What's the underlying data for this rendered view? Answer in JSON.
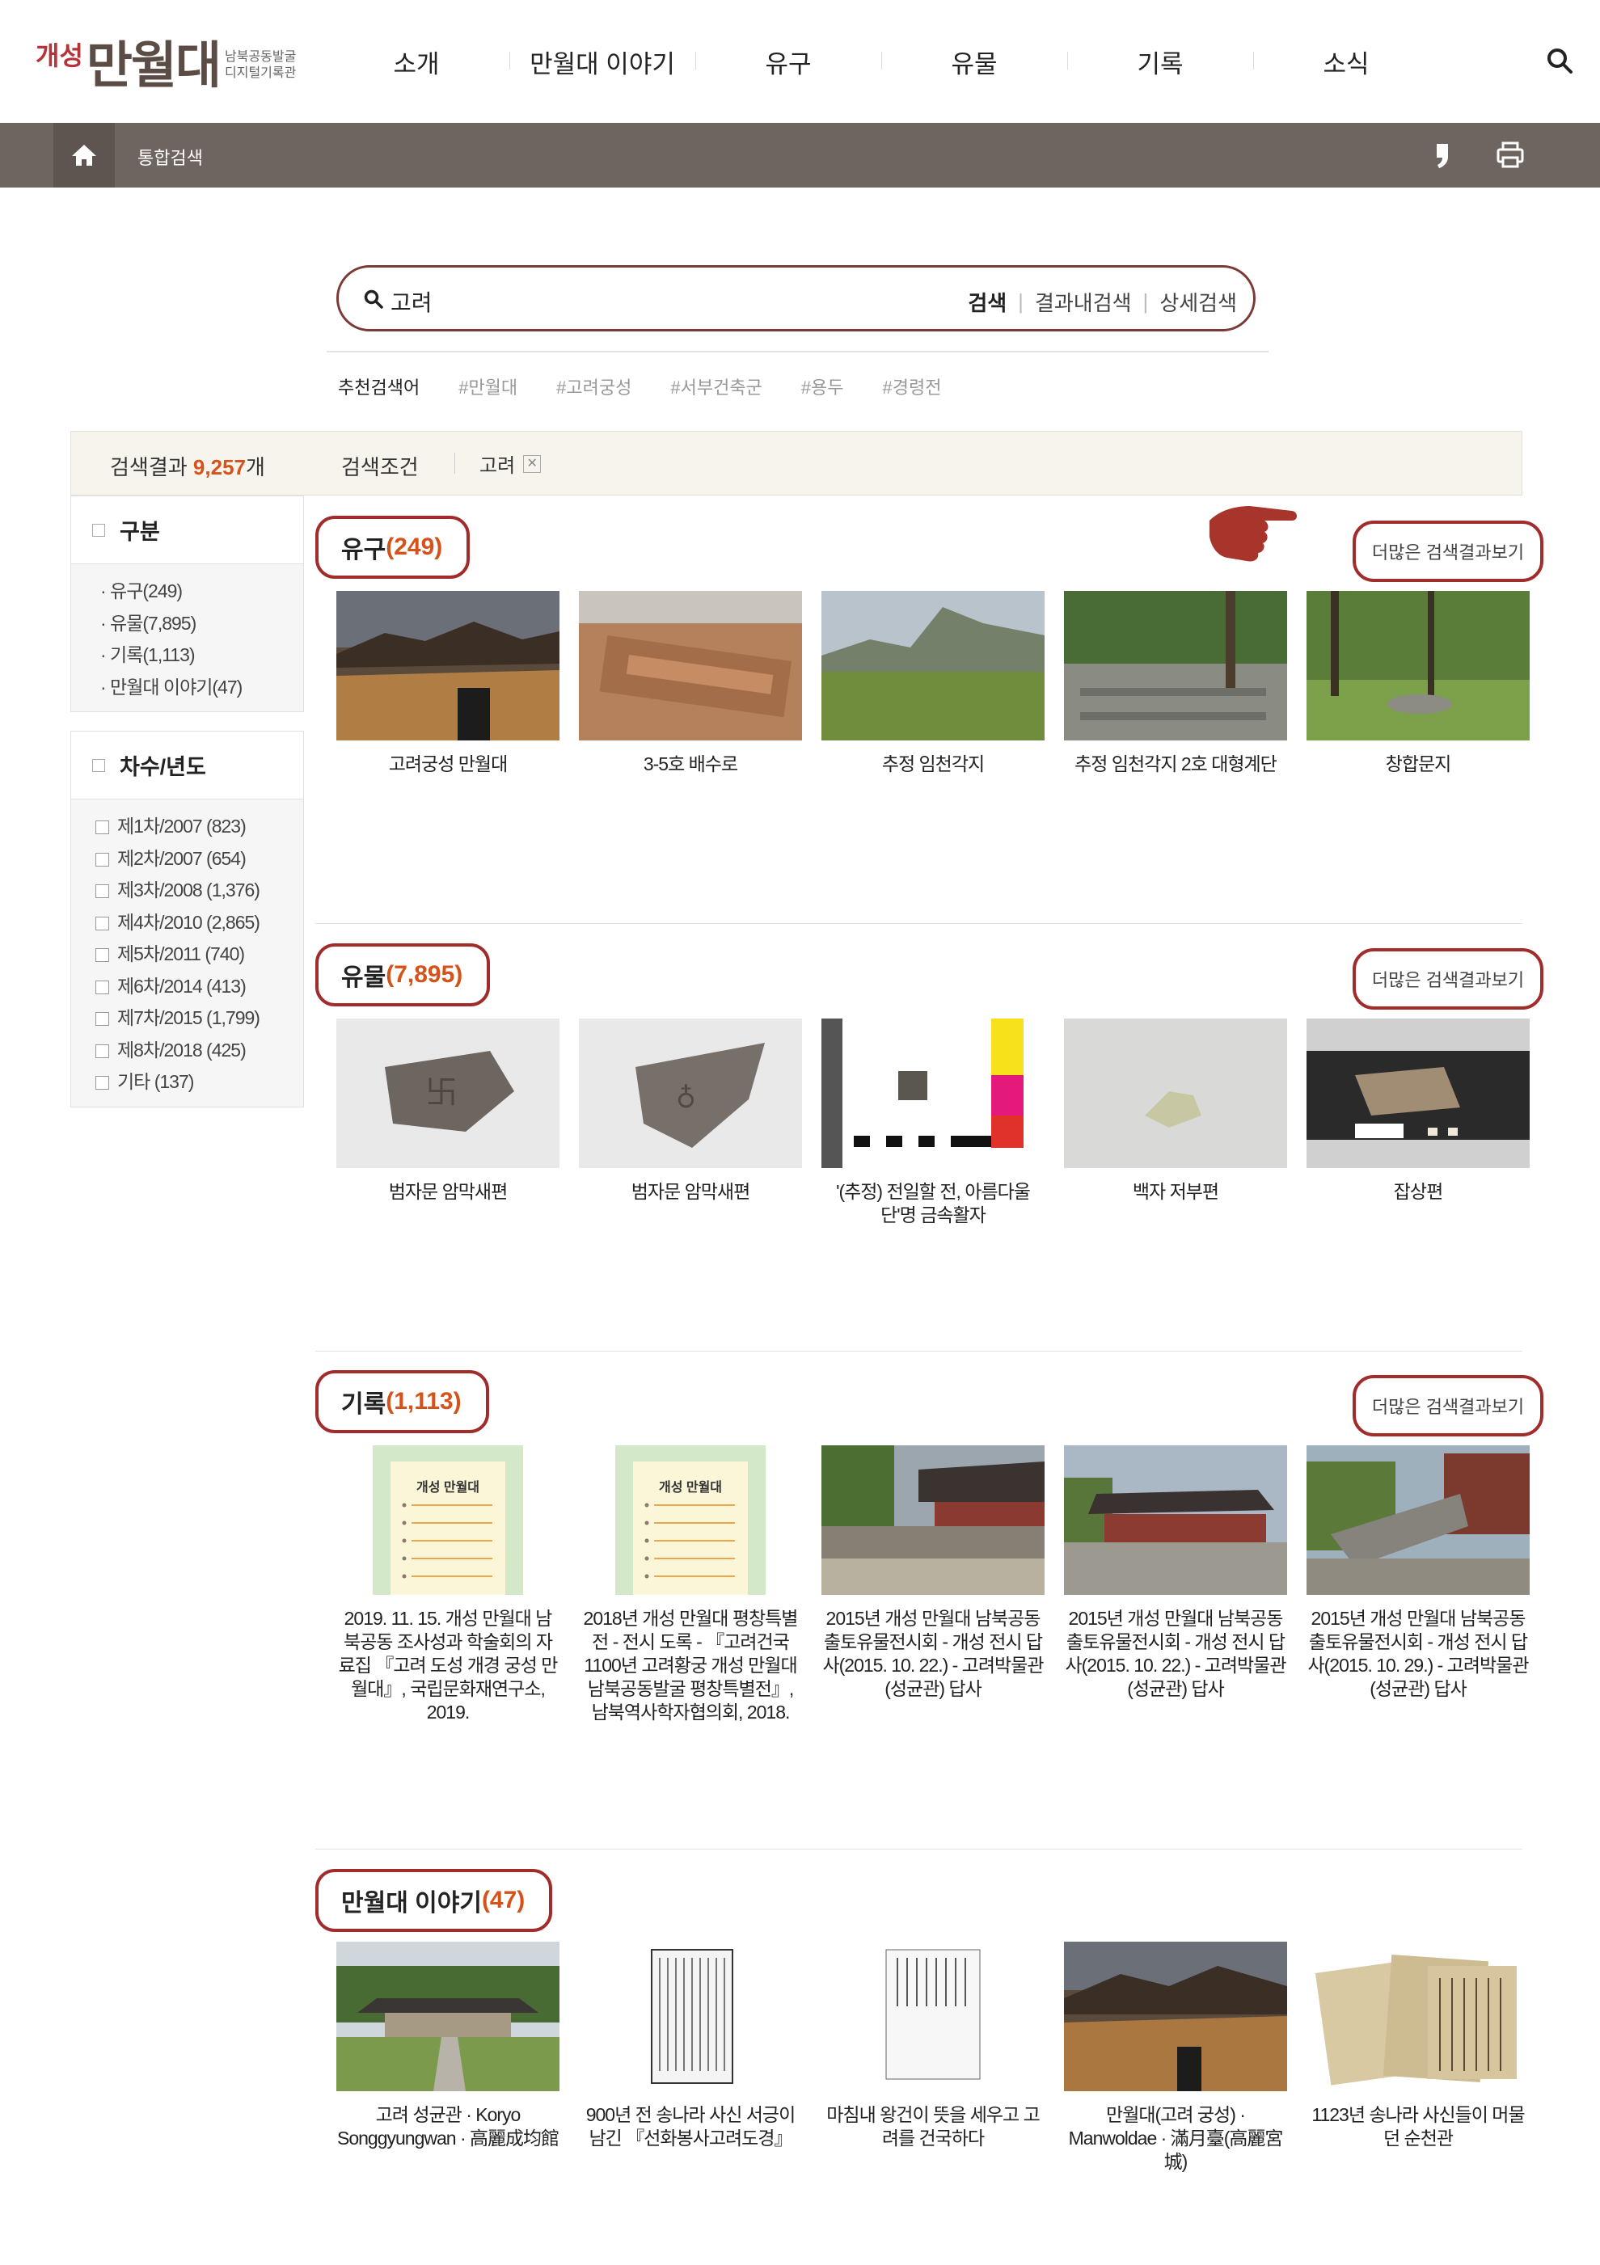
{
  "header": {
    "logo": {
      "prefix": "개성",
      "main": "만월대",
      "sub1": "남북공동발굴",
      "sub2": "디지털기록관"
    },
    "nav": [
      "소개",
      "만월대 이야기",
      "유구",
      "유물",
      "기록",
      "소식"
    ]
  },
  "location": {
    "title": "통합검색"
  },
  "search": {
    "value": "고려",
    "buttons": [
      "검색",
      "결과내검색",
      "상세검색"
    ],
    "recommend_label": "추천검색어",
    "recommend_tags": [
      "#만월대",
      "#고려궁성",
      "#서부건축군",
      "#용두",
      "#경령전"
    ]
  },
  "results": {
    "label": "검색결과",
    "count": "9,257",
    "unit": "개",
    "condition_label": "검색조건",
    "keyword": "고려"
  },
  "sidebar": {
    "category": {
      "title": "구분",
      "items": [
        "· 유구(249)",
        "· 유물(7,895)",
        "· 기록(1,113)",
        "· 만월대 이야기(47)"
      ]
    },
    "year": {
      "title": "차수/년도",
      "items": [
        "제1차/2007 (823)",
        "제2차/2007 (654)",
        "제3차/2008 (1,376)",
        "제4차/2010 (2,865)",
        "제5차/2011 (740)",
        "제6차/2014 (413)",
        "제7차/2015 (1,799)",
        "제8차/2018 (425)",
        "기타 (137)"
      ]
    }
  },
  "more_label": "더많은 검색결과보기",
  "sections": [
    {
      "name": "유구",
      "count": "(249)",
      "items": [
        "고려궁성 만월대",
        "3-5호 배수로",
        "추정 임천각지",
        "추정 임천각지 2호 대형계단",
        "창합문지"
      ]
    },
    {
      "name": "유물",
      "count": "(7,895)",
      "items": [
        "범자문 암막새편",
        "범자문 암막새편",
        "'(추정) 전일할 전, 아름다울 단'명 금속활자",
        "백자 저부편",
        "잡상편"
      ]
    },
    {
      "name": "기록",
      "count": "(1,113)",
      "book_label": "개성 만월대",
      "items": [
        "2019. 11. 15. 개성 만월대 남북공동 조사성과 학술회의 자료집 『고려 도성 개경 궁성 만월대』, 국립문화재연구소, 2019.",
        "2018년 개성 만월대 평창특별전 - 전시 도록 - 『고려건국 1100년 고려황궁 개성 만월대 남북공동발굴 평창특별전』, 남북역사학자협의회, 2018.",
        "2015년 개성 만월대 남북공동출토유물전시회 - 개성 전시 답사(2015. 10. 22.) - 고려박물관(성균관) 답사",
        "2015년 개성 만월대 남북공동출토유물전시회 - 개성 전시 답사(2015. 10. 22.) - 고려박물관(성균관) 답사",
        "2015년 개성 만월대 남북공동출토유물전시회 - 개성 전시 답사(2015. 10. 29.) - 고려박물관(성균관) 답사"
      ]
    },
    {
      "name": "만월대 이야기",
      "count": "(47)",
      "items": [
        "고려 성균관 · Koryo Songgyungwan · 高麗成均館",
        "900년 전 송나라 사신 서긍이 남긴 『선화봉사고려도경』",
        "마침내 왕건이 뜻을 세우고 고려를 건국하다",
        "만월대(고려 궁성) · Manwoldae · 滿月臺(高麗宮城)",
        "1123년 송나라 사신들이 머물던 순천관"
      ]
    }
  ],
  "colors": {
    "accent": "#a02c2c",
    "count": "#d5531a",
    "locbar": "#6e6460"
  }
}
